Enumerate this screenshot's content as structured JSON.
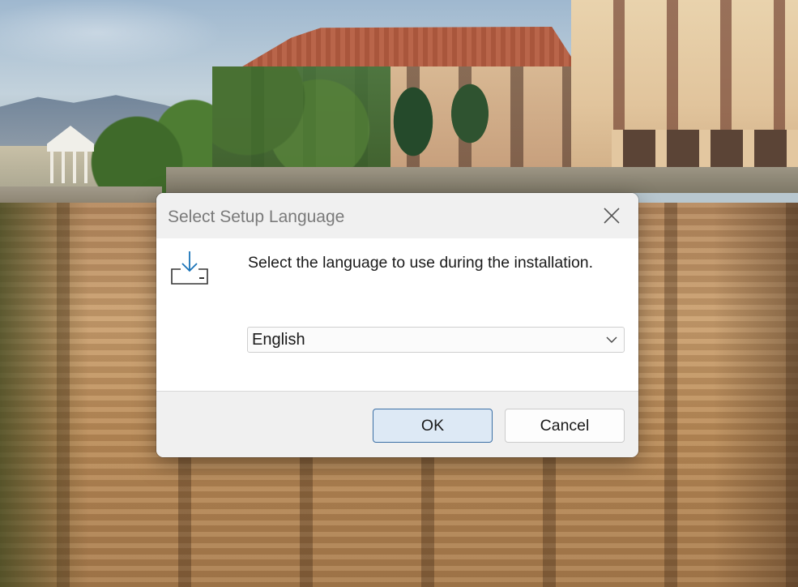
{
  "dialog": {
    "title": "Select Setup Language",
    "prompt": "Select the language to use during the installation.",
    "language_select": {
      "selected": "English"
    },
    "ok_label": "OK",
    "cancel_label": "Cancel"
  },
  "icons": {
    "close": "close-icon",
    "setup": "install-download-icon",
    "dropdown": "chevron-down-icon"
  },
  "colors": {
    "ok_border": "#3b6fa5",
    "ok_fill": "#dde9f5",
    "icon_accent": "#1a73b8"
  }
}
